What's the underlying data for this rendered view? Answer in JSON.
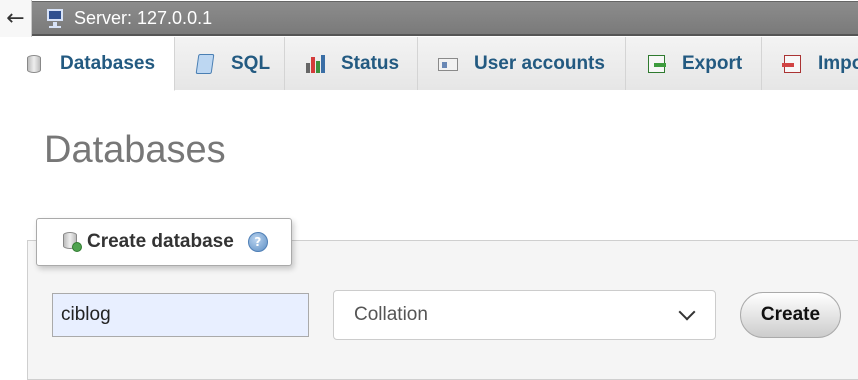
{
  "nav": {
    "back_glyph": "←"
  },
  "server": {
    "title": "Server: 127.0.0.1",
    "icon": "server-monitor-icon"
  },
  "tabs": [
    {
      "label": "Databases",
      "icon": "database-icon",
      "active": true
    },
    {
      "label": "SQL",
      "icon": "sql-scroll-icon",
      "active": false
    },
    {
      "label": "Status",
      "icon": "status-chart-icon",
      "active": false
    },
    {
      "label": "User accounts",
      "icon": "user-card-icon",
      "active": false
    },
    {
      "label": "Export",
      "icon": "export-icon",
      "active": false
    },
    {
      "label": "Impo",
      "icon": "import-icon",
      "active": false
    }
  ],
  "page": {
    "title": "Databases"
  },
  "create_db": {
    "legend_label": "Create database",
    "help_glyph": "?",
    "name_value": "ciblog",
    "collation_label": "Collation",
    "create_label": "Create"
  },
  "colors": {
    "tab_text": "#235a81",
    "server_bar": "#828282",
    "input_bg": "#e8efff"
  }
}
